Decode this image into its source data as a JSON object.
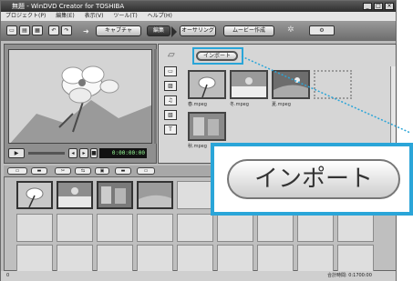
{
  "window": {
    "title": "無題 - WinDVD Creator for TOSHIBA",
    "controls": [
      "_",
      "□",
      "×"
    ]
  },
  "menu": [
    "プロジェクト(P)",
    "編集(E)",
    "表示(V)",
    "ツール(T)",
    "ヘルプ(H)"
  ],
  "toolbar": {
    "modes": [
      "キャプチャ",
      "編集",
      "オーサリング",
      "ムービー作成"
    ],
    "active_mode_index": 1
  },
  "player": {
    "timecode": "0:00:00:00"
  },
  "library": {
    "import_label": "インポート",
    "clips": [
      {
        "label": "春.mpeg"
      },
      {
        "label": "冬.mpeg"
      },
      {
        "label": "夏.mpeg"
      },
      {
        "label": ""
      },
      {
        "label": "秋.mpeg"
      }
    ]
  },
  "status": {
    "left": "0",
    "total_time_label": "合計時間: 0:1700:00"
  },
  "callout": {
    "label": "インポート"
  },
  "colors": {
    "highlight": "#2aa5d8",
    "active_tab": "#3a3a3a"
  }
}
